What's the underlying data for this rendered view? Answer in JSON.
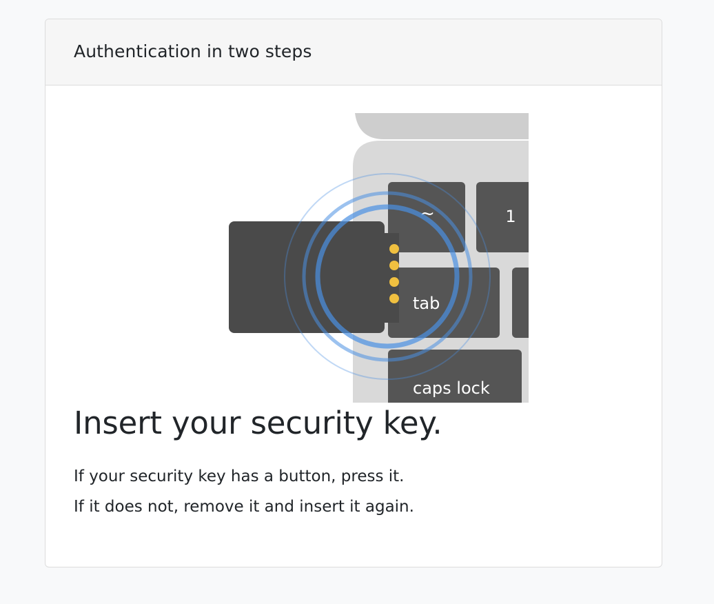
{
  "card": {
    "header_title": "Authentication in two steps"
  },
  "illustration": {
    "keys": {
      "tilde": "~",
      "one": "1",
      "tab": "tab",
      "caps_lock": "caps lock"
    },
    "colors": {
      "keyboard": "#d9d9d9",
      "key": "#555555",
      "usb_body": "#4a4a4a",
      "contacts": "#f0c040",
      "signal": "#4a90e2"
    }
  },
  "main": {
    "title": "Insert your security key.",
    "lines": [
      "If your security key has a button, press it.",
      "If it does not, remove it and insert it again."
    ]
  }
}
